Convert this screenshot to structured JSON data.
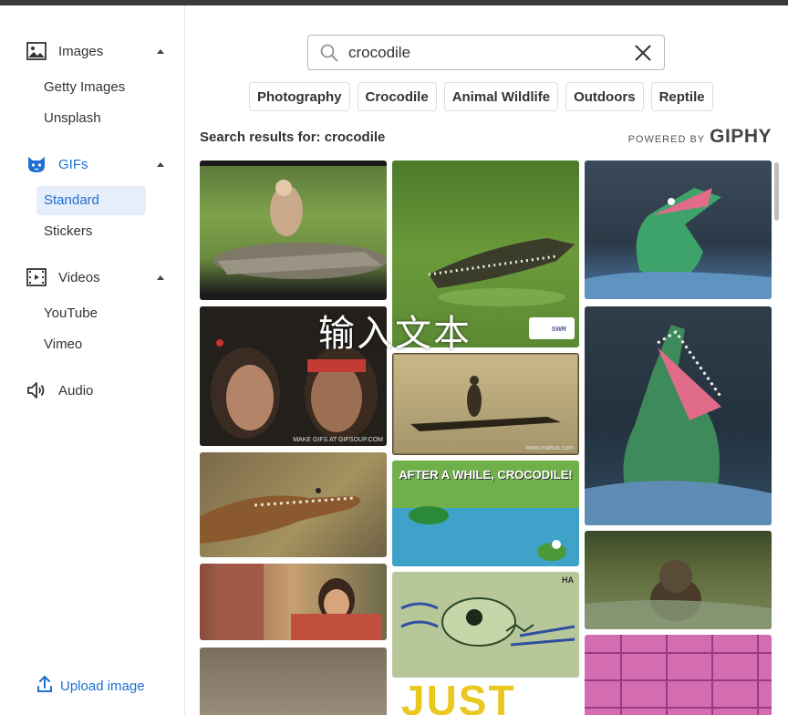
{
  "sidebar": {
    "sections": [
      {
        "label": "Images",
        "icon": "image-icon",
        "items": [
          "Getty Images",
          "Unsplash"
        ]
      },
      {
        "label": "GIFs",
        "icon": "cat-face-icon",
        "items": [
          "Standard",
          "Stickers"
        ],
        "selected": "Standard"
      },
      {
        "label": "Videos",
        "icon": "film-icon",
        "items": [
          "YouTube",
          "Vimeo"
        ]
      },
      {
        "label": "Audio",
        "icon": "speaker-icon",
        "items": []
      }
    ],
    "upload_label": "Upload image"
  },
  "search": {
    "value": "crocodile"
  },
  "chips": [
    "Photography",
    "Crocodile",
    "Animal Wildlife",
    "Outdoors",
    "Reptile"
  ],
  "results": {
    "label": "Search results for: crocodile",
    "powered_by": "POWERED BY",
    "brand": "GIPHY"
  },
  "gifs": {
    "overlay_text": "输入文本",
    "watermark_gifsoup": "MAKE GIFS AT GIFSOUP.COM",
    "watermark_swr": "SWR",
    "watermark_mahus": "www.mahus.com",
    "banner_after_a_while": "AFTER A WHILE, CROCODILE!",
    "ha_label": "HA",
    "just_text": "JUST"
  },
  "colors": {
    "accent": "#1f6fd1",
    "selected_bg": "#e6eefb"
  }
}
